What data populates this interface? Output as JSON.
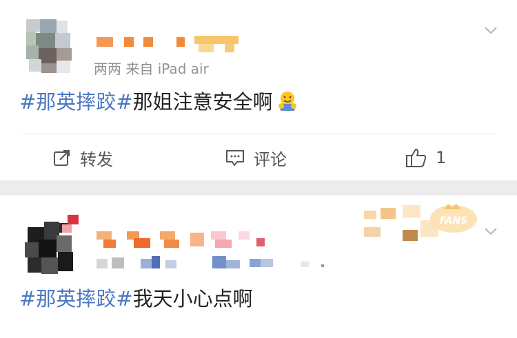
{
  "posts": [
    {
      "meta": "两两  来自 iPad air",
      "hashtag": "#那英摔跤#",
      "text": "那姐注意安全啊",
      "emoji": "hugging-face",
      "actions": {
        "repost_label": "转发",
        "comment_label": "评论",
        "like_count": "1"
      }
    },
    {
      "hashtag": "#那英摔跤#",
      "text": "我天小心点啊",
      "badge": "FANS"
    }
  ],
  "colors": {
    "topic": "#4a77c3",
    "separator": "#ececec",
    "meta": "#939393"
  }
}
